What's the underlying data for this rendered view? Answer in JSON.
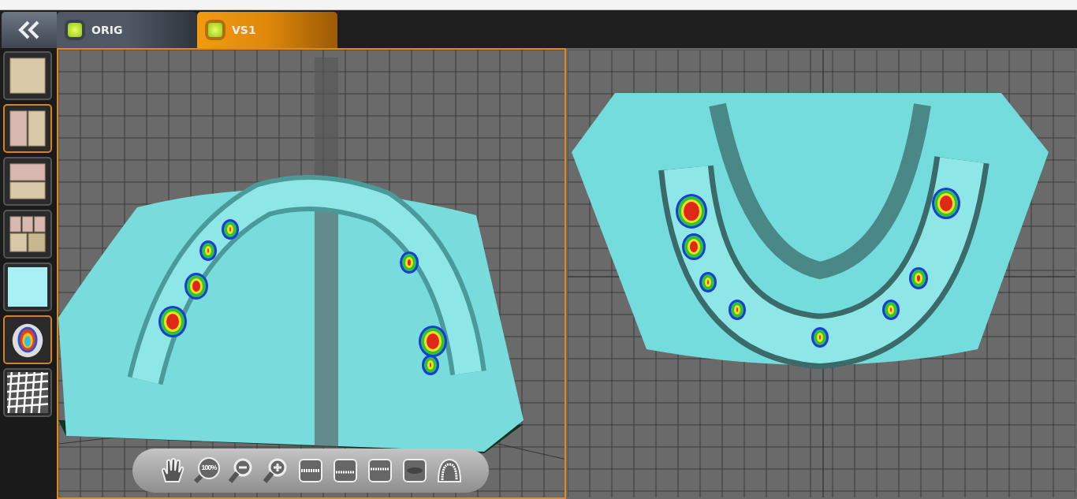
{
  "tabs": [
    {
      "label": "ORIG",
      "selected": false
    },
    {
      "label": "VS1",
      "selected": true
    }
  ],
  "layout_tools": [
    {
      "kind": "single",
      "selected": false
    },
    {
      "kind": "split-vertical",
      "selected": true
    },
    {
      "kind": "split-horizontal",
      "selected": false
    },
    {
      "kind": "split-five",
      "selected": false
    },
    {
      "kind": "plain",
      "selected": false
    },
    {
      "kind": "heatmap",
      "selected": true
    },
    {
      "kind": "mesh",
      "selected": false
    }
  ],
  "viewports": [
    {
      "kind": "perspective",
      "selected": true
    },
    {
      "kind": "occlusal",
      "selected": false
    }
  ],
  "view_tools": [
    {
      "kind": "pan"
    },
    {
      "kind": "zoom-reset",
      "label": "100%"
    },
    {
      "kind": "zoom-out"
    },
    {
      "kind": "zoom-in"
    },
    {
      "kind": "front"
    },
    {
      "kind": "upper"
    },
    {
      "kind": "lower"
    },
    {
      "kind": "open"
    },
    {
      "kind": "arch"
    }
  ]
}
